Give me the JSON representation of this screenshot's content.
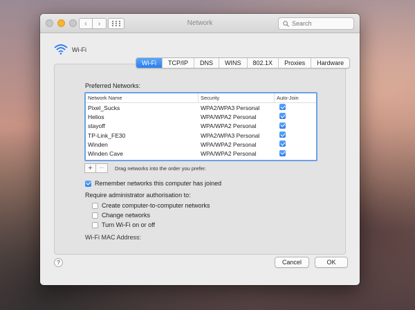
{
  "window": {
    "title": "Network",
    "search_placeholder": "Search"
  },
  "service": {
    "name": "Wi-Fi"
  },
  "tabs": [
    "Wi-Fi",
    "TCP/IP",
    "DNS",
    "WINS",
    "802.1X",
    "Proxies",
    "Hardware"
  ],
  "active_tab": "Wi-Fi",
  "preferred": {
    "label": "Preferred Networks:",
    "columns": [
      "Network Name",
      "Security",
      "Auto-Join"
    ],
    "rows": [
      {
        "name": "Pixel_Sucks",
        "security": "WPA2/WPA3 Personal",
        "auto_join": true
      },
      {
        "name": "Helios",
        "security": "WPA/WPA2 Personal",
        "auto_join": true
      },
      {
        "name": "stayoff",
        "security": "WPA/WPA2 Personal",
        "auto_join": true
      },
      {
        "name": "TP-Link_FE30",
        "security": "WPA2/WPA3 Personal",
        "auto_join": true
      },
      {
        "name": "Winden",
        "security": "WPA/WPA2 Personal",
        "auto_join": true
      },
      {
        "name": "Winden Cave",
        "security": "WPA/WPA2 Personal",
        "auto_join": true
      }
    ],
    "add_label": "+",
    "remove_label": "−",
    "drag_note": "Drag networks into the order you prefer."
  },
  "options": {
    "remember_label": "Remember networks this computer has joined",
    "remember_checked": true,
    "require_label": "Require administrator authorisation to:",
    "items": [
      {
        "label": "Create computer-to-computer networks",
        "checked": false
      },
      {
        "label": "Change networks",
        "checked": false
      },
      {
        "label": "Turn Wi-Fi on or off",
        "checked": false
      }
    ]
  },
  "mac_label": "Wi-Fi MAC Address:",
  "footer": {
    "help": "?",
    "cancel": "Cancel",
    "ok": "OK"
  },
  "colors": {
    "accent": "#2d7ef0",
    "focus_ring": "#6aa2e6"
  }
}
